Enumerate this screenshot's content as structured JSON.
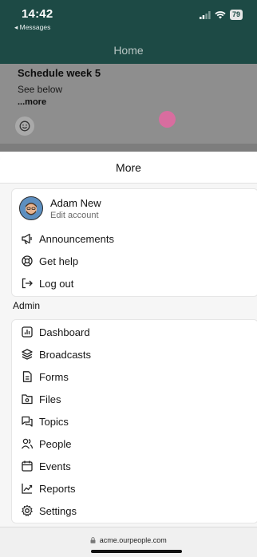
{
  "status": {
    "time": "14:42",
    "back_label": "◂ Messages",
    "battery": "79"
  },
  "header": {
    "title": "Home"
  },
  "post": {
    "title": "Schedule week 5",
    "body": "See below",
    "more": "...more"
  },
  "sheet": {
    "title": "More",
    "user": {
      "name": "Adam New",
      "edit": "Edit account"
    },
    "items": [
      {
        "label": "Announcements",
        "icon": "megaphone-icon"
      },
      {
        "label": "Get help",
        "icon": "lifebuoy-icon"
      },
      {
        "label": "Log out",
        "icon": "logout-icon"
      }
    ],
    "admin_label": "Admin",
    "admin_items": [
      {
        "label": "Dashboard",
        "icon": "chart-icon"
      },
      {
        "label": "Broadcasts",
        "icon": "layers-icon"
      },
      {
        "label": "Forms",
        "icon": "document-icon"
      },
      {
        "label": "Files",
        "icon": "folder-icon"
      },
      {
        "label": "Topics",
        "icon": "chat-icon"
      },
      {
        "label": "People",
        "icon": "people-icon"
      },
      {
        "label": "Events",
        "icon": "calendar-icon"
      },
      {
        "label": "Reports",
        "icon": "trend-icon"
      },
      {
        "label": "Settings",
        "icon": "gear-icon"
      }
    ]
  },
  "browser": {
    "url": "acme.ourpeople.com"
  },
  "colors": {
    "header_bg": "#1d4a45",
    "touch": "#d86d9f"
  }
}
